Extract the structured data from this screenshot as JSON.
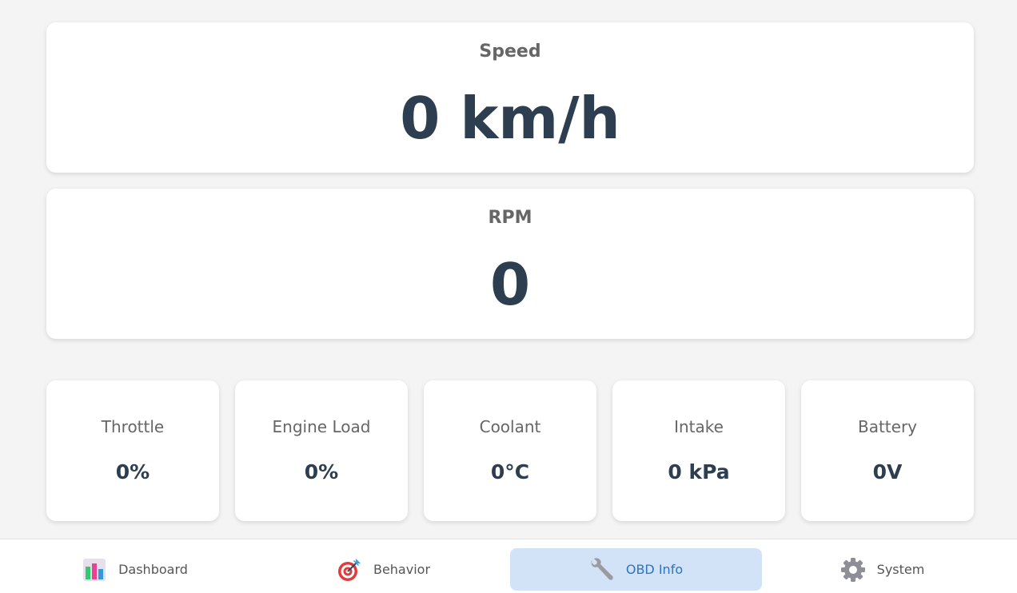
{
  "speed": {
    "label": "Speed",
    "value": "0 km/h"
  },
  "rpm": {
    "label": "RPM",
    "value": "0"
  },
  "metrics": [
    {
      "label": "Throttle",
      "value": "0%"
    },
    {
      "label": "Engine Load",
      "value": "0%"
    },
    {
      "label": "Coolant",
      "value": "0°C"
    },
    {
      "label": "Intake",
      "value": "0 kPa"
    },
    {
      "label": "Battery",
      "value": "0V"
    }
  ],
  "nav": {
    "active": "OBD Info",
    "items": [
      {
        "label": "Dashboard",
        "icon": "bar-chart-icon"
      },
      {
        "label": "Behavior",
        "icon": "target-icon"
      },
      {
        "label": "OBD Info",
        "icon": "wrench-icon"
      },
      {
        "label": "System",
        "icon": "gear-icon"
      }
    ]
  },
  "colors": {
    "value_text": "#2c3e50",
    "label_text": "#666666",
    "active_tab_bg": "#d2e3f8",
    "active_tab_text": "#2f73c4"
  }
}
